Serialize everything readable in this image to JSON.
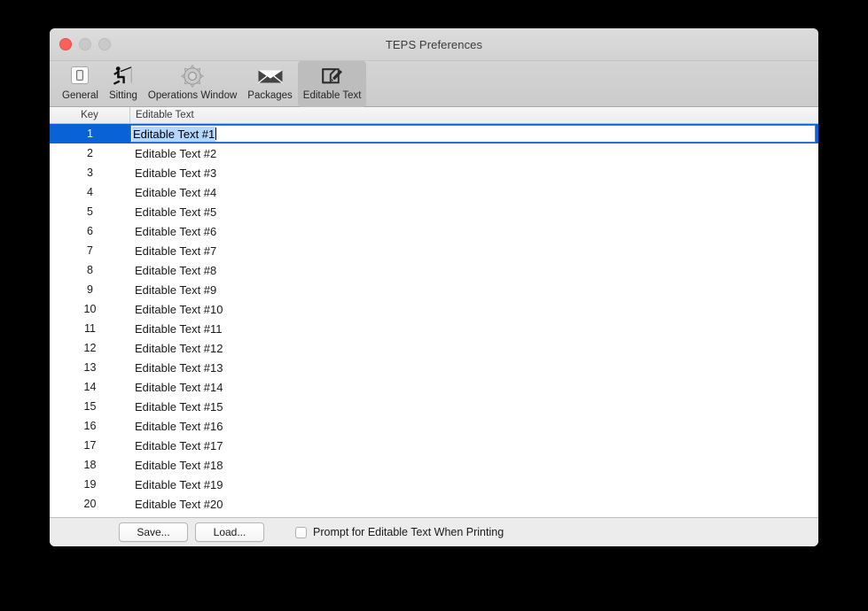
{
  "window": {
    "title": "TEPS Preferences",
    "controls": {
      "close": "close-button",
      "minimize": "minimize-button",
      "zoom": "zoom-button"
    }
  },
  "toolbar": {
    "items": [
      {
        "label": "General",
        "icon": "toggle-switch-icon",
        "selected": false
      },
      {
        "label": "Sitting",
        "icon": "person-fishing-icon",
        "selected": false
      },
      {
        "label": "Operations Window",
        "icon": "gear-icon",
        "selected": false
      },
      {
        "label": "Packages",
        "icon": "envelope-icon",
        "selected": false
      },
      {
        "label": "Editable Text",
        "icon": "pencil-note-icon",
        "selected": true
      }
    ]
  },
  "table": {
    "columns": [
      "Key",
      "Editable Text"
    ],
    "selected_row_index": 0,
    "editing": {
      "active": true,
      "value": "Editable Text #1",
      "text_selected": true
    },
    "rows": [
      {
        "key": "1",
        "text": "Editable Text #1"
      },
      {
        "key": "2",
        "text": "Editable Text #2"
      },
      {
        "key": "3",
        "text": "Editable Text #3"
      },
      {
        "key": "4",
        "text": "Editable Text #4"
      },
      {
        "key": "5",
        "text": "Editable Text #5"
      },
      {
        "key": "6",
        "text": "Editable Text #6"
      },
      {
        "key": "7",
        "text": "Editable Text #7"
      },
      {
        "key": "8",
        "text": "Editable Text #8"
      },
      {
        "key": "9",
        "text": "Editable Text #9"
      },
      {
        "key": "10",
        "text": "Editable Text #10"
      },
      {
        "key": "11",
        "text": "Editable Text #11"
      },
      {
        "key": "12",
        "text": "Editable Text #12"
      },
      {
        "key": "13",
        "text": "Editable Text #13"
      },
      {
        "key": "14",
        "text": "Editable Text #14"
      },
      {
        "key": "15",
        "text": "Editable Text #15"
      },
      {
        "key": "16",
        "text": "Editable Text #16"
      },
      {
        "key": "17",
        "text": "Editable Text #17"
      },
      {
        "key": "18",
        "text": "Editable Text #18"
      },
      {
        "key": "19",
        "text": "Editable Text #19"
      },
      {
        "key": "20",
        "text": "Editable Text #20"
      }
    ]
  },
  "bottom_bar": {
    "save_label": "Save...",
    "load_label": "Load...",
    "checkbox_label": "Prompt for Editable Text When Printing",
    "checkbox_checked": false
  },
  "colors": {
    "selection_blue": "#0a63d6",
    "text_selection_blue": "#b3d7ff",
    "close_red": "#fc605c",
    "window_chrome": "#ececec"
  }
}
